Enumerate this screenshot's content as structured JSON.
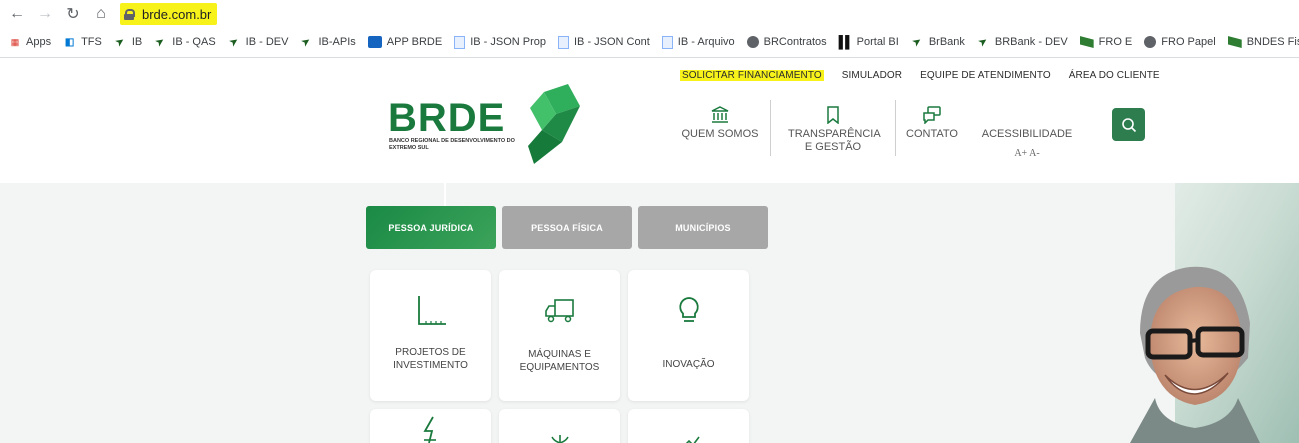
{
  "browser": {
    "url": "brde.com.br",
    "bookmarks": [
      {
        "label": "Apps",
        "icon": "apps-grid-icon"
      },
      {
        "label": "TFS",
        "icon": "tfs-icon"
      },
      {
        "label": "IB",
        "icon": "green-arrow-icon"
      },
      {
        "label": "IB - QAS",
        "icon": "green-arrow-icon"
      },
      {
        "label": "IB - DEV",
        "icon": "green-arrow-icon"
      },
      {
        "label": "IB-APIs",
        "icon": "green-arrow-icon"
      },
      {
        "label": "APP BRDE",
        "icon": "brde-app-icon"
      },
      {
        "label": "IB - JSON Prop",
        "icon": "document-icon"
      },
      {
        "label": "IB - JSON Cont",
        "icon": "document-icon"
      },
      {
        "label": "IB - Arquivo",
        "icon": "document-icon"
      },
      {
        "label": "BRContratos",
        "icon": "globe-icon"
      },
      {
        "label": "Portal BI",
        "icon": "bar-chart-icon"
      },
      {
        "label": "BrBank",
        "icon": "green-arrow-icon"
      },
      {
        "label": "BRBank - DEV",
        "icon": "green-arrow-icon"
      },
      {
        "label": "FRO E",
        "icon": "fro-icon"
      },
      {
        "label": "FRO Papel",
        "icon": "globe-icon"
      },
      {
        "label": "BNDES Fisc",
        "icon": "fro-icon"
      }
    ]
  },
  "header": {
    "top_links": [
      "SOLICITAR FINANCIAMENTO",
      "SIMULADOR",
      "EQUIPE DE ATENDIMENTO",
      "ÁREA DO CLIENTE"
    ],
    "logo_text": "BRDE",
    "logo_subtitle": "BANCO REGIONAL DE DESENVOLVIMENTO DO EXTREMO SUL",
    "nav": {
      "quem_somos": "QUEM SOMOS",
      "transparencia": "TRANSPARÊNCIA E GESTÃO",
      "contato": "CONTATO",
      "acessibilidade": "ACESSIBILIDADE",
      "font_controls": "A+ A-"
    }
  },
  "tabs": [
    "PESSOA JURÍDICA",
    "PESSOA FÍSICA",
    "MUNICÍPIOS"
  ],
  "cards": [
    {
      "label": "PROJETOS DE INVESTIMENTO",
      "icon": "chart-axis-icon"
    },
    {
      "label": "MÁQUINAS E EQUIPAMENTOS",
      "icon": "truck-icon"
    },
    {
      "label": "INOVAÇÃO",
      "icon": "lightbulb-icon"
    }
  ],
  "colors": {
    "brand_green": "#1a7a3e",
    "highlight": "#f7f21a",
    "inactive_tab": "#a7a7a7"
  }
}
